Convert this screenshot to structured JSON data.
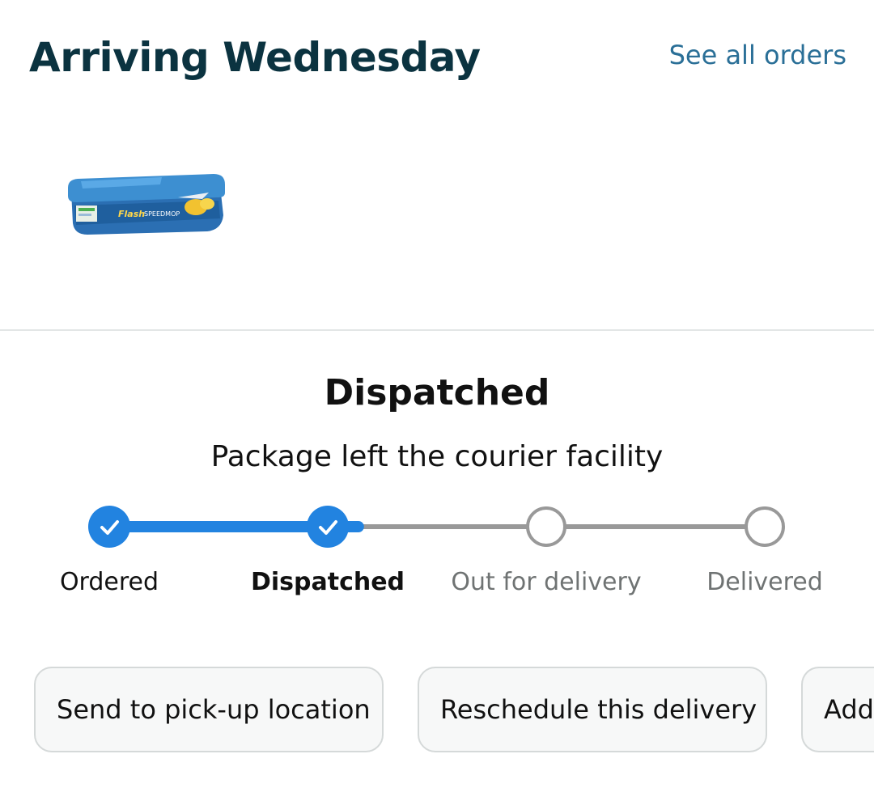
{
  "header": {
    "title": "Arriving Wednesday",
    "see_all_orders": "See all orders"
  },
  "product": {
    "image_icon": "wipes-package-image",
    "brand_text": "Flash",
    "product_text": "SPEEDMOP"
  },
  "status": {
    "title": "Dispatched",
    "subtitle": "Package left the courier facility"
  },
  "tracker": {
    "current_step_index": 1,
    "progress_fraction": 0.38,
    "steps": [
      {
        "label": "Ordered",
        "state": "done"
      },
      {
        "label": "Dispatched",
        "state": "current"
      },
      {
        "label": "Out for delivery",
        "state": "pending"
      },
      {
        "label": "Delivered",
        "state": "pending"
      }
    ],
    "colors": {
      "complete": "#2283e0",
      "pending": "#999999"
    }
  },
  "actions": [
    {
      "label": "Send to pick-up location"
    },
    {
      "label": "Reschedule this delivery"
    },
    {
      "label": "Add"
    }
  ]
}
